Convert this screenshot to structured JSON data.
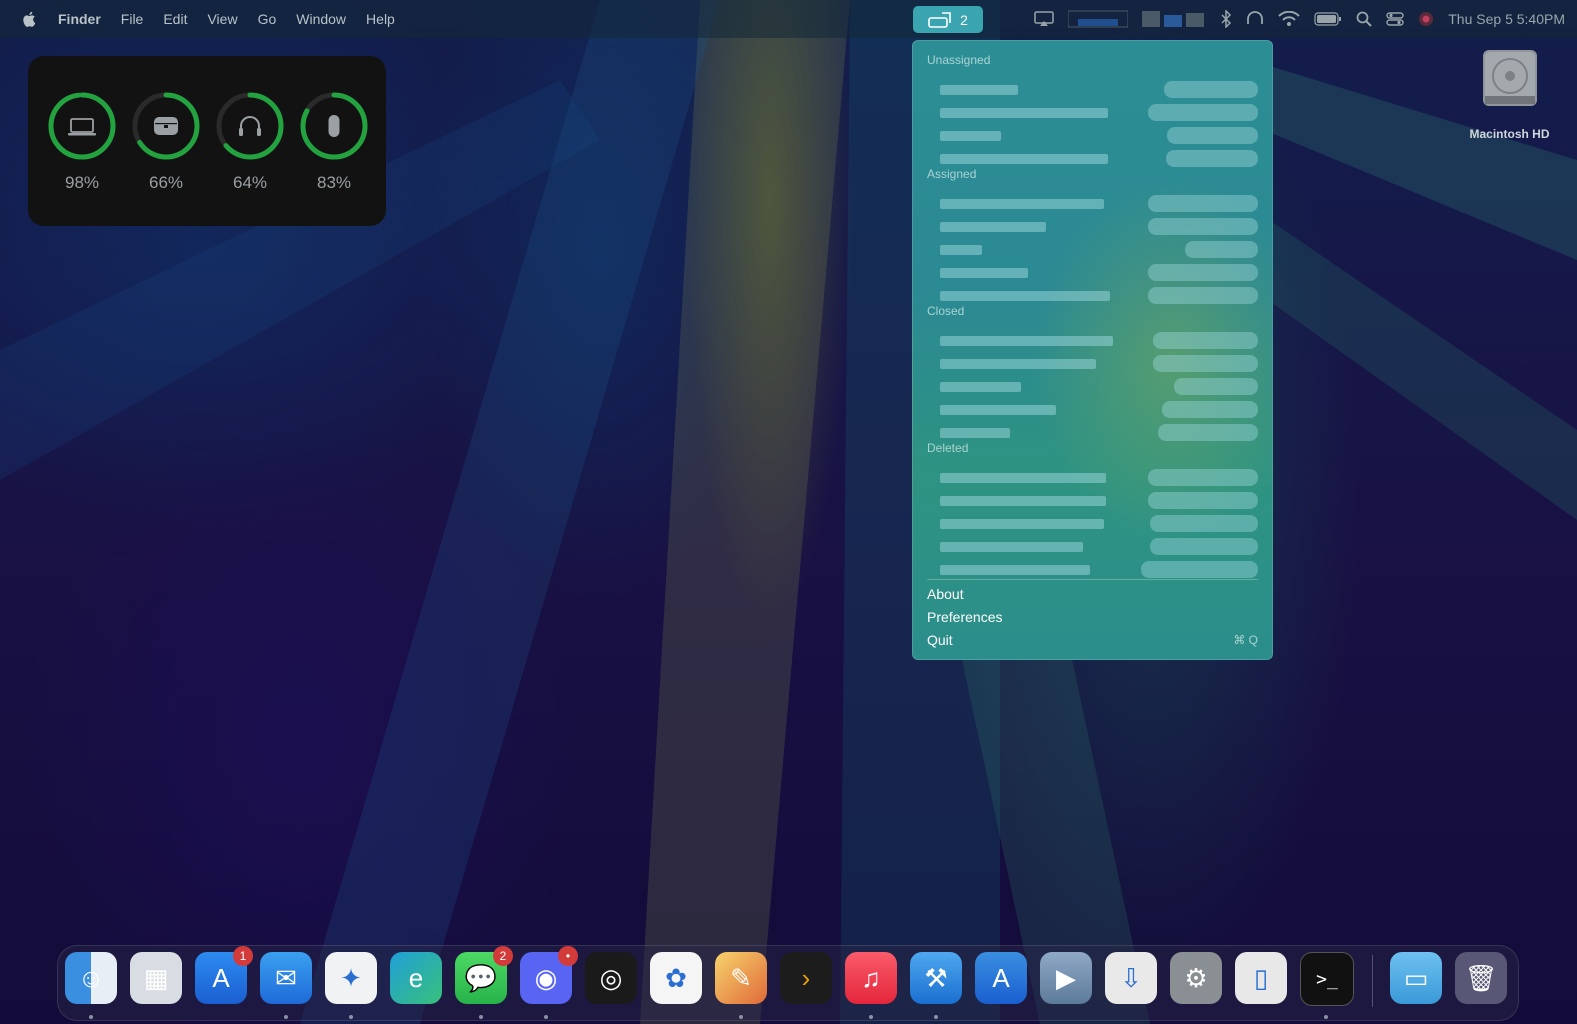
{
  "menubar": {
    "items": [
      "Finder",
      "File",
      "Edit",
      "View",
      "Go",
      "Window",
      "Help"
    ],
    "active_status_count": "2",
    "clock": "Thu Sep 5  5:40PM"
  },
  "battery_widget": {
    "devices": [
      {
        "icon": "laptop-icon",
        "percent": "98%",
        "level": 0.98
      },
      {
        "icon": "airpods-case-icon",
        "percent": "66%",
        "level": 0.66
      },
      {
        "icon": "headphones-icon",
        "percent": "64%",
        "level": 0.64
      },
      {
        "icon": "mouse-icon",
        "percent": "83%",
        "level": 0.83
      }
    ],
    "ring_color": "#23a33f"
  },
  "dropdown": {
    "sections": [
      {
        "title": "Unassigned",
        "rows": 4
      },
      {
        "title": "Assigned",
        "rows": 5
      },
      {
        "title": "Closed",
        "rows": 5
      },
      {
        "title": "Deleted",
        "rows": 5
      }
    ],
    "actions": {
      "about": "About",
      "preferences": "Preferences",
      "quit": "Quit",
      "quit_shortcut": "⌘ Q"
    }
  },
  "desktop": {
    "drive_label": "Macintosh HD"
  },
  "dock": {
    "apps": [
      {
        "name": "finder",
        "badge": ""
      },
      {
        "name": "launchpad",
        "badge": ""
      },
      {
        "name": "app-store",
        "badge": "1"
      },
      {
        "name": "mail",
        "badge": ""
      },
      {
        "name": "safari",
        "badge": ""
      },
      {
        "name": "edge-dev",
        "badge": ""
      },
      {
        "name": "messages",
        "badge": "2"
      },
      {
        "name": "discord",
        "badge": "•"
      },
      {
        "name": "logic",
        "badge": ""
      },
      {
        "name": "photos",
        "badge": ""
      },
      {
        "name": "pixelmator",
        "badge": ""
      },
      {
        "name": "plex",
        "badge": ""
      },
      {
        "name": "music",
        "badge": ""
      },
      {
        "name": "xcode-beta",
        "badge": ""
      },
      {
        "name": "instruments-beta",
        "badge": ""
      },
      {
        "name": "script-editor",
        "badge": ""
      },
      {
        "name": "transmit",
        "badge": ""
      },
      {
        "name": "system-settings",
        "badge": ""
      },
      {
        "name": "simulator",
        "badge": ""
      },
      {
        "name": "terminal",
        "badge": ""
      },
      {
        "name": "downloads-folder",
        "badge": ""
      },
      {
        "name": "trash",
        "badge": ""
      }
    ]
  }
}
